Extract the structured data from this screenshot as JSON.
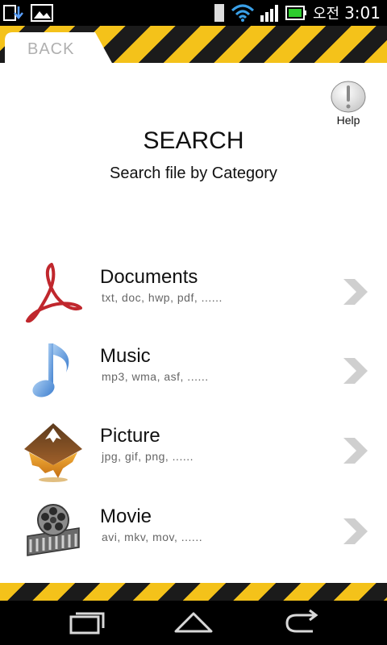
{
  "status_bar": {
    "ampm": "오전",
    "time": "3:01"
  },
  "header": {
    "back_label": "BACK"
  },
  "help": {
    "label": "Help"
  },
  "main": {
    "title": "SEARCH",
    "subtitle": "Search file by Category"
  },
  "categories": [
    {
      "title": "Documents",
      "formats": "txt, doc, hwp, pdf, ......",
      "icon": "pdf-document-icon"
    },
    {
      "title": "Music",
      "formats": "mp3, wma, asf, ......",
      "icon": "music-note-icon"
    },
    {
      "title": "Picture",
      "formats": "jpg, gif, png, ......",
      "icon": "picture-icon"
    },
    {
      "title": "Movie",
      "formats": "avi, mkv, mov, ......",
      "icon": "film-reel-icon"
    }
  ],
  "colors": {
    "hazard_yellow": "#f4c21a",
    "hazard_black": "#1b1b1b"
  }
}
